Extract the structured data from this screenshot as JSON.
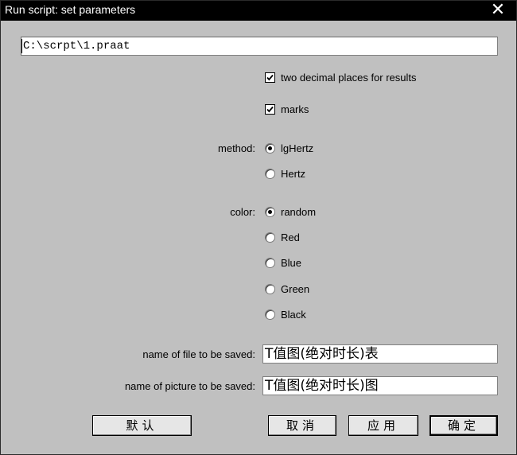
{
  "window": {
    "title": "Run script: set parameters",
    "close_glyph": "✕"
  },
  "script_path": {
    "value": "C:\\scrpt\\1.praat"
  },
  "options": {
    "two_decimal": {
      "label": "two decimal places for results",
      "checked": true
    },
    "marks": {
      "label": "marks",
      "checked": true
    }
  },
  "method": {
    "label": "method:",
    "options": [
      {
        "label": "lgHertz",
        "selected": true
      },
      {
        "label": "Hertz",
        "selected": false
      }
    ]
  },
  "color": {
    "label": "color:",
    "options": [
      {
        "label": "random",
        "selected": true
      },
      {
        "label": "Red",
        "selected": false
      },
      {
        "label": "Blue",
        "selected": false
      },
      {
        "label": "Green",
        "selected": false
      },
      {
        "label": "Black",
        "selected": false
      }
    ]
  },
  "fields": {
    "file_name": {
      "label": "name of file to be saved:",
      "value": "T值图(绝对时长)表"
    },
    "picture_name": {
      "label": "name of picture to be saved:",
      "value": "T值图(绝对时长)图"
    }
  },
  "buttons": {
    "standards": "默认",
    "cancel": "取消",
    "apply": "应用",
    "ok": "确定"
  }
}
